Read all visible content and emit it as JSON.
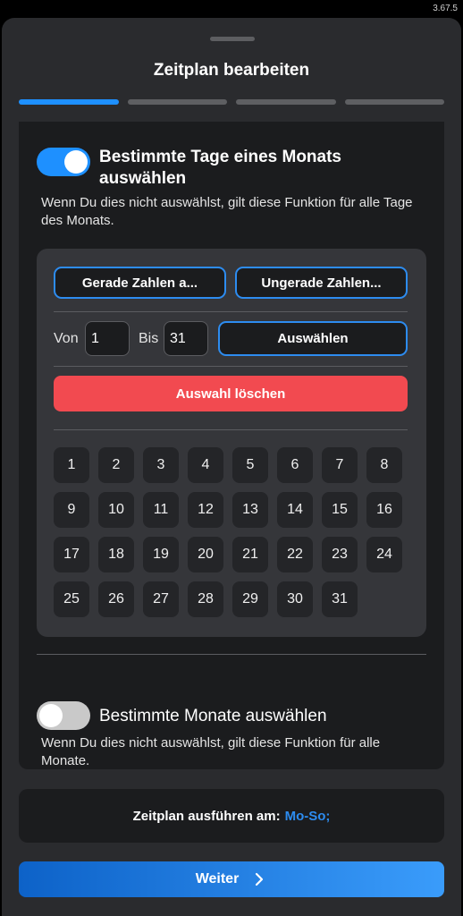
{
  "status_bar": {
    "version": "3.67.5"
  },
  "sheet": {
    "title": "Zeitplan bearbeiten",
    "steps_total": 4,
    "steps_active": 1
  },
  "days_of_month": {
    "enabled": true,
    "title": "Bestimmte Tage eines Monats auswählen",
    "description": "Wenn Du dies nicht auswählst, gilt diese Funktion für alle Tage des Monats.",
    "even_button": "Gerade Zahlen a...",
    "odd_button": "Ungerade Zahlen...",
    "from_label": "Von",
    "from_value": "1",
    "to_label": "Bis",
    "to_value": "31",
    "select_button": "Auswählen",
    "clear_button": "Auswahl löschen",
    "days": [
      "1",
      "2",
      "3",
      "4",
      "5",
      "6",
      "7",
      "8",
      "9",
      "10",
      "11",
      "12",
      "13",
      "14",
      "15",
      "16",
      "17",
      "18",
      "19",
      "20",
      "21",
      "22",
      "23",
      "24",
      "25",
      "26",
      "27",
      "28",
      "29",
      "30",
      "31"
    ]
  },
  "months": {
    "enabled": false,
    "title": "Bestimmte Monate auswählen",
    "description": "Wenn Du dies nicht auswählst, gilt diese Funktion für alle Monate."
  },
  "summary": {
    "label": "Zeitplan ausführen am:",
    "value": "Mo-So;"
  },
  "next_button": {
    "label": "Weiter",
    "icon": "chevron-right-icon"
  },
  "colors": {
    "accent": "#1e90ff",
    "danger": "#f24a50",
    "background": "#2a2b2e",
    "card": "#1b1c1e"
  }
}
